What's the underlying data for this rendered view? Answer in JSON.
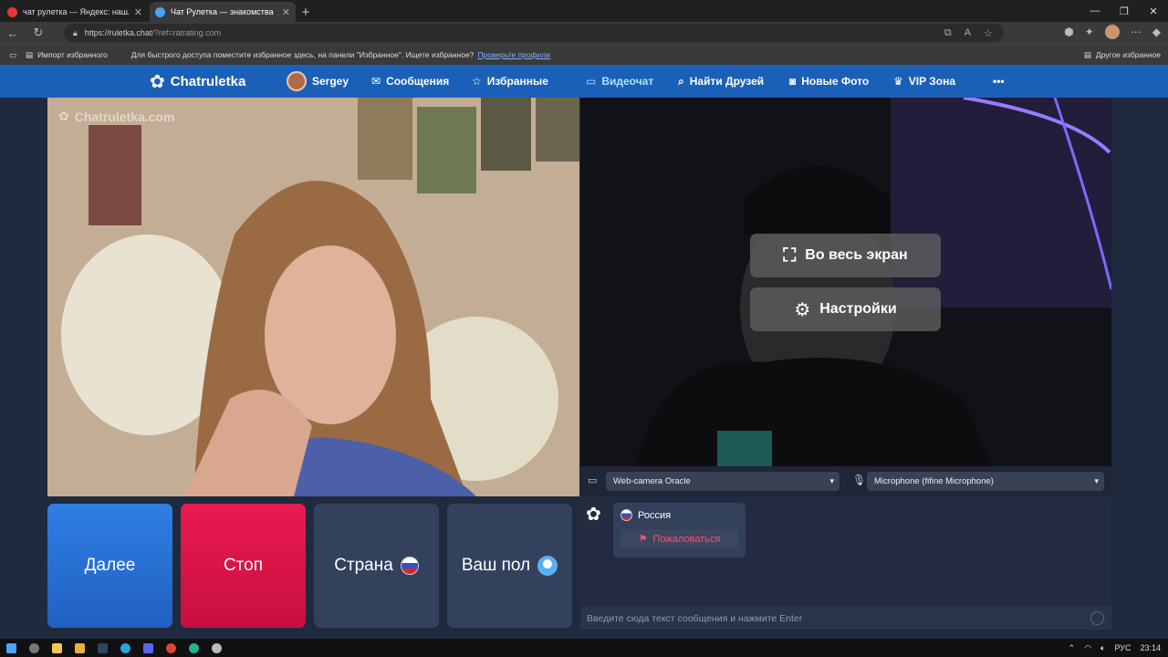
{
  "browser": {
    "tabs": [
      {
        "title": "чат рулетка — Яндекс: нашлось",
        "fav_color": "#e53935"
      },
      {
        "title": "Чат Рулетка — знакомства",
        "fav_color": "#4aa3ff"
      }
    ],
    "url_host": "https://ruletka.chat",
    "url_rest": "/?ref=ratrating.com",
    "bookmarks": {
      "import": "Импорт избранного",
      "hint": "Для быстрого доступа поместите избранное здесь, на панели \"Избранное\". Ищете избранное?",
      "link": "Проверьте профили",
      "other": "Другое избранное"
    }
  },
  "nav": {
    "logo": "Chatruletka",
    "user": "Sergey",
    "messages": "Сообщения",
    "favorites": "Избранные",
    "videochat": "Видеочат",
    "find_friends": "Найти Друзей",
    "new_photos": "Новые Фото",
    "vip": "VIP Зона",
    "more": "•••"
  },
  "video": {
    "watermark": "Chatruletka.com",
    "fullscreen_label": "Во весь экран",
    "settings_label": "Настройки",
    "camera_select": "Web-camera Oracle",
    "mic_select": "Microphone (fifine Microphone)"
  },
  "controls": {
    "next": "Далее",
    "stop": "Стоп",
    "country": "Страна",
    "gender": "Ваш пол"
  },
  "chat": {
    "country": "Россия",
    "report": "Пожаловаться",
    "input_placeholder": "Введите сюда текст сообщения и нажмите Enter"
  },
  "taskbar": {
    "lang": "РУС",
    "time": "23:14"
  },
  "colors": {
    "nav_bg": "#1b60b8",
    "next_btn": "#2a6fd6",
    "stop_btn": "#e0144a",
    "dark_btn": "#33415c",
    "report_text": "#ff4d6a"
  }
}
